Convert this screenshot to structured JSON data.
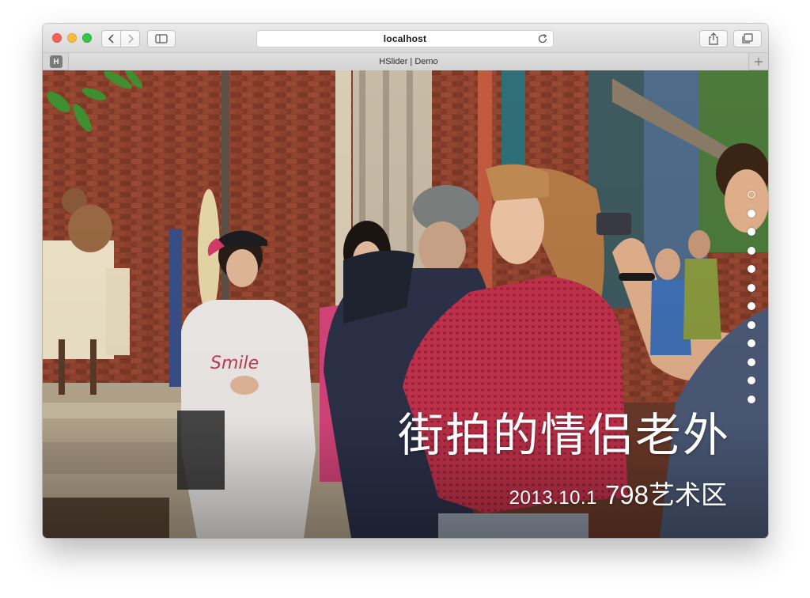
{
  "browser": {
    "url": "localhost",
    "tab_title": "HSlider | Demo",
    "favicon_letter": "H",
    "new_tab_symbol": "+"
  },
  "icons": {
    "back": "chevron-left-icon",
    "forward": "chevron-right-icon",
    "sidebar": "sidebar-icon",
    "reload": "reload-icon",
    "share": "share-icon",
    "tabs": "tabs-overview-icon"
  },
  "slider": {
    "title": "街拍的情侣老外",
    "date": "2013.10.1",
    "location": "798艺术区",
    "dot_count": 12,
    "active_index": 0
  },
  "colors": {
    "close": "#fc605c",
    "minimize": "#fdbc40",
    "maximize": "#34c84a"
  }
}
